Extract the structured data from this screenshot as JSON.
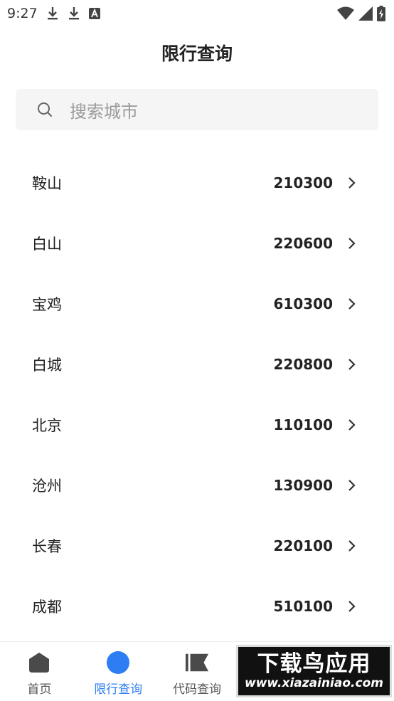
{
  "status_bar": {
    "time": "9:27",
    "notifications": [
      "download-icon",
      "download-icon",
      "font-a-icon"
    ],
    "indicators": [
      "wifi-icon",
      "cell-signal-icon",
      "battery-charging-icon"
    ]
  },
  "page": {
    "title": "限行查询"
  },
  "search": {
    "placeholder": "搜索城市"
  },
  "cities": [
    {
      "name": "鞍山",
      "code": "210300"
    },
    {
      "name": "白山",
      "code": "220600"
    },
    {
      "name": "宝鸡",
      "code": "610300"
    },
    {
      "name": "白城",
      "code": "220800"
    },
    {
      "name": "北京",
      "code": "110100"
    },
    {
      "name": "沧州",
      "code": "130900"
    },
    {
      "name": "长春",
      "code": "220100"
    },
    {
      "name": "成都",
      "code": "510100"
    }
  ],
  "tabs": [
    {
      "label": "首页",
      "icon": "home-icon",
      "active": false
    },
    {
      "label": "限行查询",
      "icon": "circle-icon",
      "active": true
    },
    {
      "label": "代码查询",
      "icon": "flag-icon",
      "active": false
    },
    {
      "label": "",
      "icon": "",
      "active": false
    },
    {
      "label": "",
      "icon": "",
      "active": false
    }
  ],
  "watermark": {
    "title": "下载鸟应用",
    "url": "www.xiazainiao.com"
  },
  "colors": {
    "accent": "#2d7ef2",
    "text": "#222222",
    "placeholder": "#9a9a9a",
    "search_bg": "#f5f5f5"
  }
}
